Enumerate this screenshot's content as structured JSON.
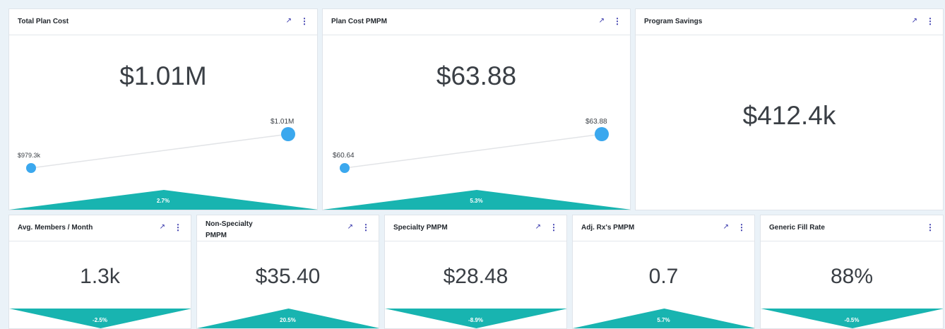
{
  "colors": {
    "accent": "#18b4b0",
    "point": "#3ba8ee",
    "background": "#eaf2f8"
  },
  "icons": {
    "expand": "arrow-up-right-icon",
    "menu": "vertical-dots-icon"
  },
  "cards": {
    "total_plan_cost": {
      "title": "Total Plan Cost",
      "value": "$1.01M",
      "start_label": "$979.3k",
      "end_label": "$1.01M",
      "change": "2.7%",
      "direction": "up"
    },
    "plan_cost_pmpm": {
      "title": "Plan Cost PMPM",
      "value": "$63.88",
      "start_label": "$60.64",
      "end_label": "$63.88",
      "change": "5.3%",
      "direction": "up"
    },
    "program_savings": {
      "title": "Program Savings",
      "value": "$412.4k"
    },
    "avg_members": {
      "title": "Avg. Members / Month",
      "value": "1.3k",
      "change": "-2.5%",
      "direction": "down"
    },
    "non_specialty_pmpm": {
      "title": "Non-Specialty PMPM",
      "value": "$35.40",
      "change": "20.5%",
      "direction": "up"
    },
    "specialty_pmpm": {
      "title": "Specialty PMPM",
      "value": "$28.48",
      "change": "-8.9%",
      "direction": "down"
    },
    "adj_rx_pmpm": {
      "title": "Adj. Rx's PMPM",
      "value": "0.7",
      "change": "5.7%",
      "direction": "up"
    },
    "generic_fill_rate": {
      "title": "Generic Fill Rate",
      "value": "88%",
      "change": "-0.5%",
      "direction": "down"
    }
  }
}
